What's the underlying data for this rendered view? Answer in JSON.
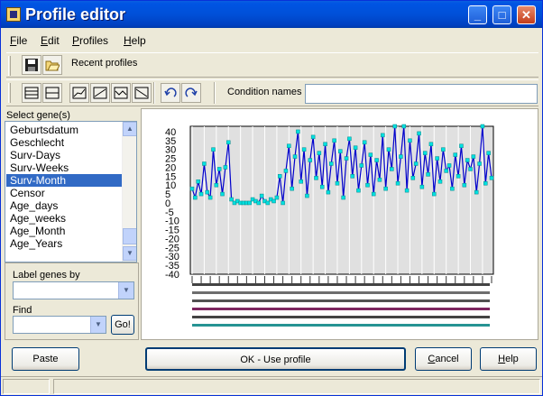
{
  "window": {
    "title": "Profile editor"
  },
  "menu": [
    {
      "key": "F",
      "rest": "ile"
    },
    {
      "key": "E",
      "rest": "dit"
    },
    {
      "key": "P",
      "rest": "rofiles"
    },
    {
      "key": "H",
      "rest": "elp"
    }
  ],
  "toolbar": {
    "recent_profiles": "Recent profiles",
    "condition_label": "Condition names",
    "condition_value": ""
  },
  "genes": {
    "label": "Select gene(s)",
    "items": [
      "Geburtsdatum",
      "Geschlecht",
      "Surv-Days",
      "Surv-Weeks",
      "Surv-Month",
      "Censor",
      "Age_days",
      "Age_weeks",
      "Age_Month",
      "Age_Years"
    ],
    "selected_index": 4
  },
  "label_genes_by": {
    "label": "Label genes by",
    "value": ""
  },
  "find": {
    "label": "Find",
    "value": "",
    "go": "Go!"
  },
  "buttons": {
    "paste": "Paste",
    "ok": "OK - Use profile",
    "cancel_key": "C",
    "cancel_rest": "ancel",
    "help_key": "H",
    "help_rest": "elp"
  },
  "colors": {
    "plot_bg": "#e0e0e0",
    "line": "#0000cc",
    "marker": "#00e0e0",
    "selection": "#316ac5"
  },
  "chart_data": {
    "type": "line",
    "yticks": [
      "40",
      "35",
      "30",
      "25",
      "20",
      "15",
      "10",
      "5",
      "0",
      "-5",
      "-10",
      "-15",
      "-20",
      "-25",
      "-30",
      "-35",
      "-40"
    ],
    "ylim": [
      -40,
      43
    ],
    "x_count": 100,
    "values": [
      8,
      3,
      12,
      5,
      22,
      6,
      3,
      30,
      10,
      19,
      5,
      20,
      34,
      2,
      0,
      1,
      0,
      0,
      0,
      0,
      2,
      1,
      0,
      4,
      1,
      0,
      2,
      1,
      3,
      15,
      0,
      18,
      32,
      8,
      26,
      40,
      12,
      30,
      4,
      24,
      37,
      14,
      28,
      9,
      33,
      6,
      22,
      35,
      11,
      29,
      3,
      25,
      36,
      15,
      31,
      7,
      21,
      34,
      10,
      27,
      5,
      24,
      13,
      38,
      8,
      30,
      19,
      43,
      11,
      26,
      43,
      7,
      35,
      14,
      22,
      39,
      9,
      28,
      16,
      33,
      5,
      25,
      12,
      30,
      18,
      21,
      8,
      27,
      15,
      32,
      10,
      24,
      19,
      26,
      6,
      22,
      43,
      11,
      28,
      14
    ]
  }
}
